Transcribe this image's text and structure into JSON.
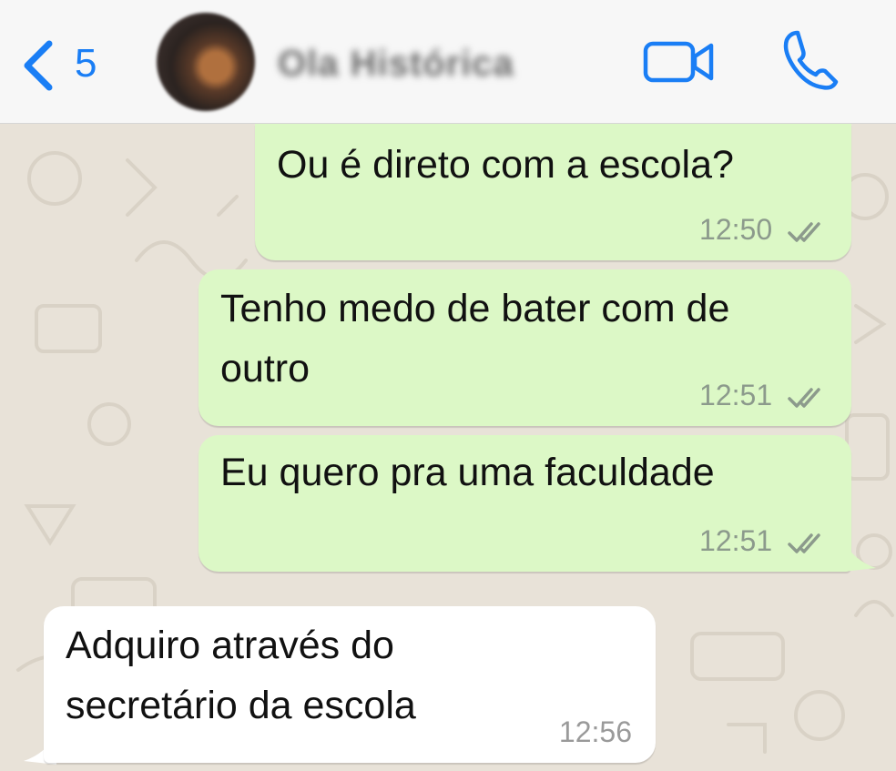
{
  "header": {
    "back_count": "5",
    "contact_name": "Ola Histórica"
  },
  "messages": [
    {
      "direction": "outgoing",
      "text": "Ou é direto com a escola?",
      "time": "12:50",
      "status": "read"
    },
    {
      "direction": "outgoing",
      "text": "Tenho medo de bater com de outro",
      "time": "12:51",
      "status": "read"
    },
    {
      "direction": "outgoing",
      "text": "Eu quero pra uma faculdade",
      "time": "12:51",
      "status": "read"
    },
    {
      "direction": "incoming",
      "text": "Adquiro através do secretário da escola",
      "time": "12:56"
    }
  ],
  "colors": {
    "accent": "#1a7ef5",
    "outgoing_bubble": "#dcf8c6",
    "incoming_bubble": "#ffffff",
    "wallpaper": "#e8e2d8"
  }
}
